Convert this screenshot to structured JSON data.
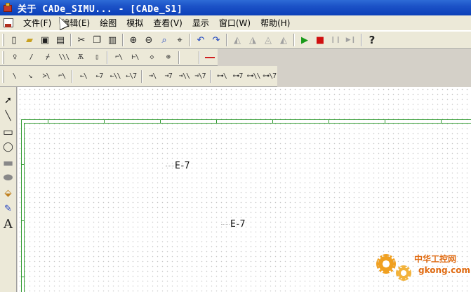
{
  "window": {
    "title": "关于 CADe_SIMU... - [CADe_S1]"
  },
  "menubar": {
    "items": [
      "文件(F)",
      "编辑(E)",
      "绘图",
      "模拟",
      "查看(V)",
      "显示",
      "窗口(W)",
      "帮助(H)"
    ]
  },
  "toolbar_main": {
    "buttons": [
      {
        "icon": "new-file-icon",
        "glyph": "▯"
      },
      {
        "icon": "open-folder-icon",
        "glyph": "▰"
      },
      {
        "icon": "save-icon",
        "glyph": "▣"
      },
      {
        "icon": "print-icon",
        "glyph": "▤"
      },
      {
        "icon": "cut-icon",
        "glyph": "✂"
      },
      {
        "icon": "copy-icon",
        "glyph": "❐"
      },
      {
        "icon": "paste-icon",
        "glyph": "▥"
      },
      {
        "icon": "zoom-in-icon",
        "glyph": "⊕"
      },
      {
        "icon": "zoom-out-icon",
        "glyph": "⊖"
      },
      {
        "icon": "zoom-fit-icon",
        "glyph": "⌕"
      },
      {
        "icon": "zoom-window-icon",
        "glyph": "⌖"
      },
      {
        "icon": "undo-icon",
        "glyph": "↶"
      },
      {
        "icon": "redo-icon",
        "glyph": "↷"
      },
      {
        "icon": "align-left-icon",
        "glyph": "◭"
      },
      {
        "icon": "align-center-icon",
        "glyph": "◮"
      },
      {
        "icon": "flip-icon",
        "glyph": "◬"
      },
      {
        "icon": "mirror-icon",
        "glyph": "◭"
      },
      {
        "icon": "run-icon",
        "glyph": "▶"
      },
      {
        "icon": "stop-icon",
        "glyph": "■"
      },
      {
        "icon": "pause-icon",
        "glyph": "❙❙"
      },
      {
        "icon": "step-icon",
        "glyph": "▶❙"
      },
      {
        "icon": "help-icon",
        "glyph": "?"
      }
    ]
  },
  "toolbar_symbols": {
    "buttons": [
      {
        "icon": "terminal-icon",
        "glyph": "♀"
      },
      {
        "icon": "contact-no-icon",
        "glyph": "/"
      },
      {
        "icon": "contact-nc-icon",
        "glyph": "⌿"
      },
      {
        "icon": "multi-contact-icon",
        "glyph": "\\\\\\"
      },
      {
        "icon": "breaker-icon",
        "glyph": "Ѫ"
      },
      {
        "icon": "fuse-icon",
        "glyph": "▯"
      },
      {
        "icon": "switch-icon",
        "glyph": "⌐\\"
      },
      {
        "icon": "switch-nc-icon",
        "glyph": "⊢\\"
      },
      {
        "icon": "diode-icon",
        "glyph": "◇"
      },
      {
        "icon": "node-icon",
        "glyph": "⊕"
      },
      {
        "icon": "wire-icon",
        "glyph": ""
      }
    ]
  },
  "toolbar_contacts": {
    "buttons": [
      {
        "icon": "contact-1-icon",
        "glyph": "\\"
      },
      {
        "icon": "contact-2-icon",
        "glyph": "↘"
      },
      {
        "icon": "contact-3-icon",
        "glyph": "≻\\"
      },
      {
        "icon": "contact-4-icon",
        "glyph": "⌐\\"
      },
      {
        "icon": "pushbutton-no-icon",
        "glyph": "←\\"
      },
      {
        "icon": "pushbutton-nc-icon",
        "glyph": "←7"
      },
      {
        "icon": "pushbutton-dual-icon",
        "glyph": "←\\\\"
      },
      {
        "icon": "pushbutton-dual-nc-icon",
        "glyph": "←\\7"
      },
      {
        "icon": "rotary-no-icon",
        "glyph": "⊸\\"
      },
      {
        "icon": "rotary-nc-icon",
        "glyph": "⊸7"
      },
      {
        "icon": "rotary-dual-icon",
        "glyph": "⊸\\\\"
      },
      {
        "icon": "rotary-dual-nc-icon",
        "glyph": "⊸\\7"
      },
      {
        "icon": "mushroom-no-icon",
        "glyph": "⊶\\"
      },
      {
        "icon": "mushroom-nc-icon",
        "glyph": "⊶7"
      },
      {
        "icon": "mushroom-dual-icon",
        "glyph": "⊶\\\\"
      },
      {
        "icon": "mushroom-dual-nc-icon",
        "glyph": "⊶\\7"
      }
    ]
  },
  "palette": {
    "tools": [
      {
        "icon": "arrow-select-icon",
        "glyph": "➚"
      },
      {
        "icon": "line-tool-icon",
        "glyph": "╲"
      },
      {
        "icon": "rectangle-tool-icon",
        "glyph": "▭"
      },
      {
        "icon": "ellipse-tool-icon",
        "glyph": "◯"
      },
      {
        "icon": "filled-rect-tool-icon",
        "glyph": "▬"
      },
      {
        "icon": "filled-ellipse-tool-icon",
        "glyph": "⬬"
      },
      {
        "icon": "fill-bucket-icon",
        "glyph": "⬙"
      },
      {
        "icon": "color-picker-icon",
        "glyph": "✎"
      },
      {
        "icon": "text-tool-icon",
        "glyph": "A"
      }
    ]
  },
  "canvas": {
    "symbols": [
      {
        "name": "pushbutton-symbol-1",
        "text": "E-7"
      },
      {
        "name": "pushbutton-symbol-2",
        "text": "E-7"
      }
    ]
  },
  "watermark": {
    "text_cn": "中华工控网",
    "url": "gkong.com"
  },
  "colors": {
    "titlebar": "#0b3fb8",
    "frame": "#2e9a2e",
    "watermark": "#e06a10"
  }
}
